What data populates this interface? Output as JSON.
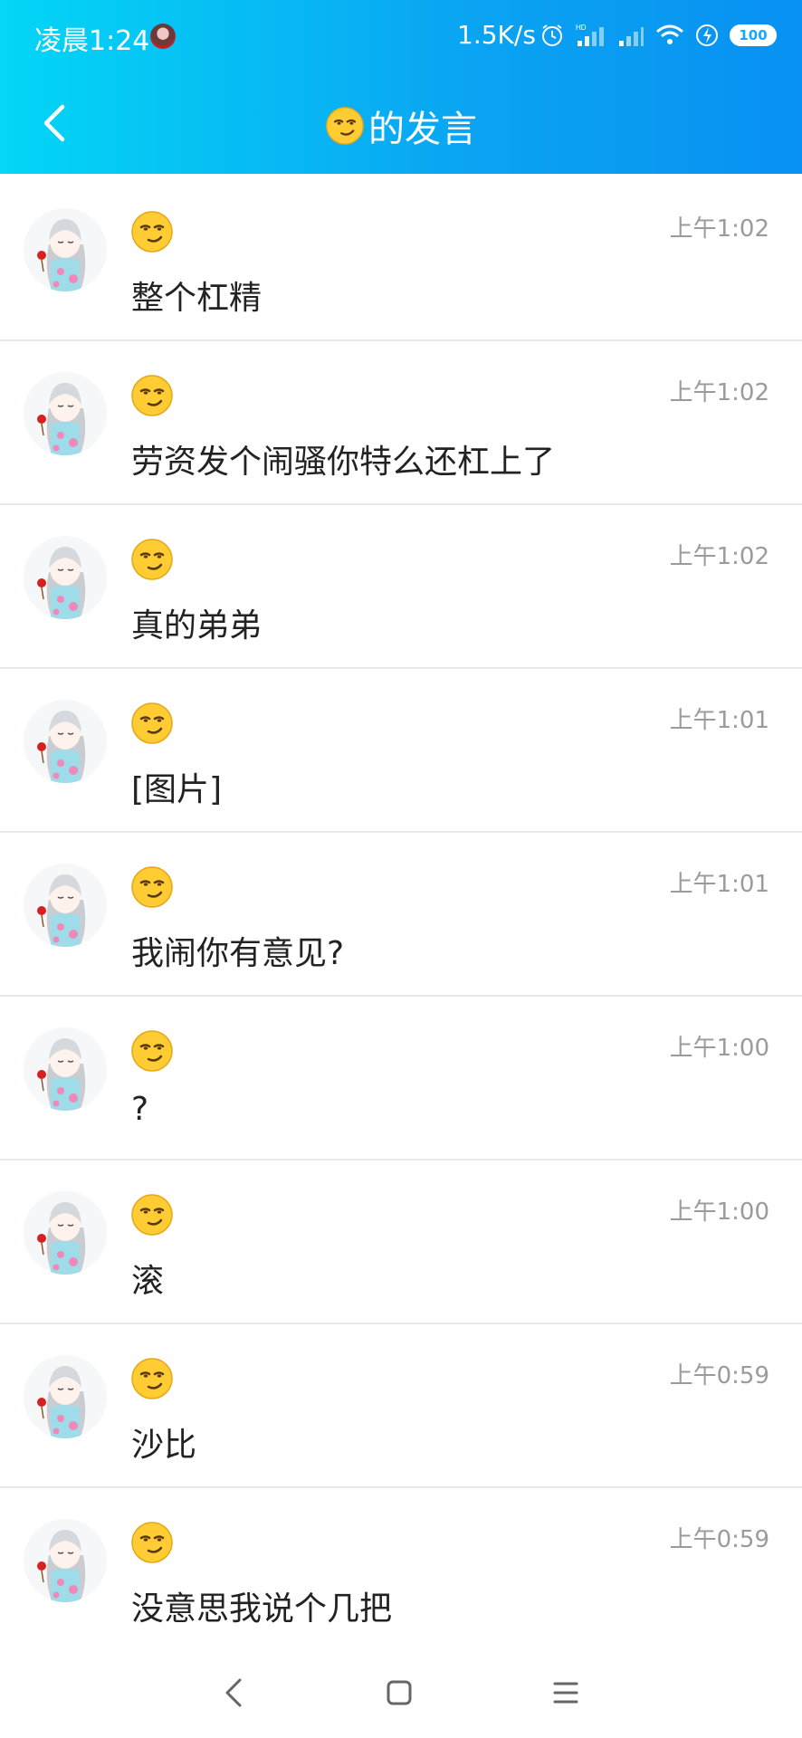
{
  "status_bar": {
    "time": "凌晨1:24",
    "network_speed": "1.5K/s",
    "battery_level": "100",
    "icons": [
      "alarm-icon",
      "hd-signal-icon",
      "signal-icon",
      "wifi-icon",
      "charging-icon",
      "battery-icon"
    ]
  },
  "header": {
    "title_emoji": "smirk-emoji",
    "title_text": "的发言",
    "back_icon": "chevron-left-icon"
  },
  "messages": [
    {
      "time": "上午1:02",
      "text": "整个杠精"
    },
    {
      "time": "上午1:02",
      "text": "劳资发个闹骚你特么还杠上了"
    },
    {
      "time": "上午1:02",
      "text": "真的弟弟"
    },
    {
      "time": "上午1:01",
      "text": "[图片]"
    },
    {
      "time": "上午1:01",
      "text": "我闹你有意见?"
    },
    {
      "time": "上午1:00",
      "text": "?"
    },
    {
      "time": "上午1:00",
      "text": "滚"
    },
    {
      "time": "上午0:59",
      "text": "沙比"
    },
    {
      "time": "上午0:59",
      "text": "没意思我说个几把"
    }
  ],
  "colors": {
    "header_gradient_start": "#03d6f6",
    "header_gradient_end": "#0891f2",
    "timestamp": "#9b9b9b",
    "message_text": "#222222",
    "divider": "#e9e9e9"
  },
  "bottom_nav": {
    "icons": [
      "back-triangle-icon",
      "home-square-icon",
      "menu-icon"
    ]
  }
}
